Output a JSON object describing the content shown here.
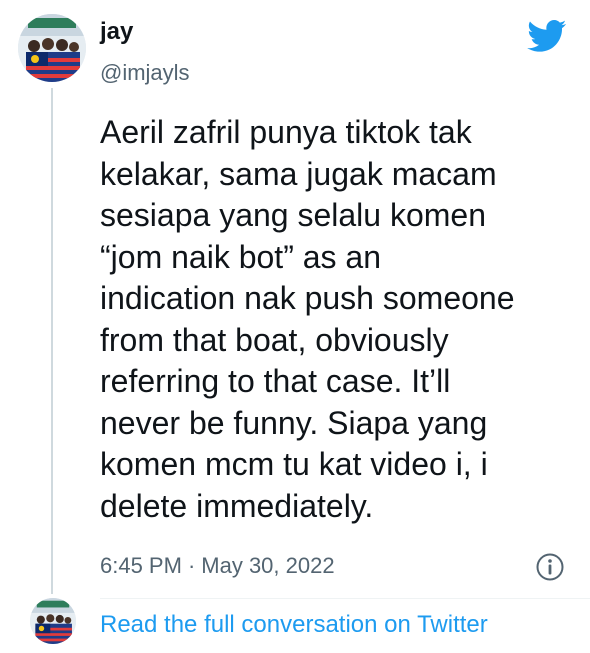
{
  "author": {
    "name": "jay",
    "handle": "@imjayls"
  },
  "tweet": {
    "text": "Aeril zafril punya tiktok tak\nkelakar, sama jugak macam\nsesiapa yang selalu komen\n“jom naik bot” as an\nindication nak push someone\nfrom that boat, obviously\nreferring to that case. It’ll\nnever be funny. Siapa yang\nkomen mcm tu kat video i, i\ndelete immediately.",
    "time": "6:45 PM",
    "separator": "·",
    "date": "May 30, 2022"
  },
  "footer": {
    "link_label": "Read the full conversation on Twitter"
  },
  "icons": {
    "brand": "twitter-bird-icon",
    "info": "info-icon"
  },
  "colors": {
    "brand_blue": "#1d9bf0",
    "text": "#0f1419",
    "muted": "#536471"
  }
}
